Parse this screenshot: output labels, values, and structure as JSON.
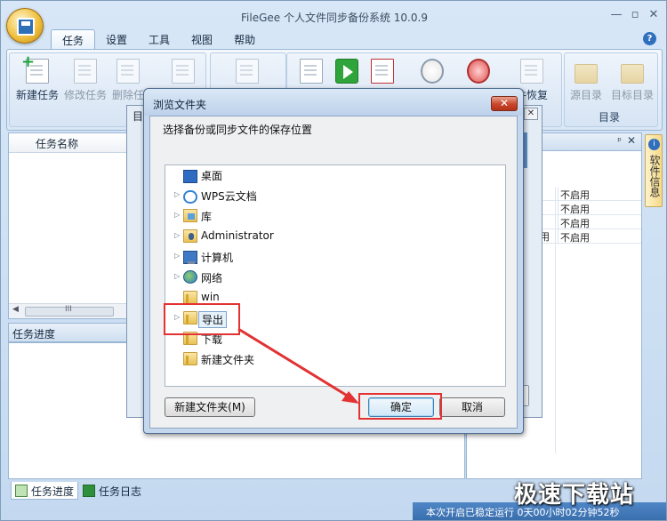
{
  "app": {
    "title": "FileGee 个人文件同步备份系统 10.0.9",
    "window_controls": [
      "—",
      "▫",
      "✕"
    ]
  },
  "menu": {
    "items": [
      "任务",
      "设置",
      "工具",
      "视图",
      "帮助"
    ],
    "active": "任务"
  },
  "ribbon": {
    "buttons": [
      {
        "label": "新建任务",
        "icon": "new-task-icon"
      },
      {
        "label": "修改任务",
        "icon": "edit-task-icon"
      },
      {
        "label": "删除任",
        "icon": "delete-task-icon"
      },
      {
        "label": "件恢复",
        "icon": "restore-icon"
      },
      {
        "label": "源目录",
        "icon": "source-folder-icon"
      },
      {
        "label": "目标目录",
        "icon": "target-folder-icon"
      }
    ],
    "group_label": "目录"
  },
  "left_pane": {
    "column_header": "任务名称",
    "scroll_marker": "III"
  },
  "progress_panel": {
    "title": "任务进度"
  },
  "bottom_tabs": [
    "任务进度",
    "任务日志"
  ],
  "right_pane": {
    "rows": [
      {
        "c1": "",
        "c2": "不启用"
      },
      {
        "c1": "",
        "c2": "不启用"
      },
      {
        "c1": "",
        "c2": "不启用"
      },
      {
        "c1": "用",
        "c2": "不启用"
      }
    ],
    "pin": "ᵖ",
    "close": "✕"
  },
  "side_tab": {
    "label": "软件信息"
  },
  "background_dialog": {
    "tab": "目",
    "close": "✕"
  },
  "dialog": {
    "title": "浏览文件夹",
    "close": "✕",
    "description": "选择备份或同步文件的保存位置",
    "tree": [
      {
        "label": "桌面",
        "icon": "desktop-icon",
        "arrow": ""
      },
      {
        "label": "WPS云文档",
        "icon": "cloud-icon",
        "arrow": "▷"
      },
      {
        "label": "库",
        "icon": "library-icon",
        "arrow": "▷"
      },
      {
        "label": "Administrator",
        "icon": "user-folder-icon",
        "arrow": "▷"
      },
      {
        "label": "计算机",
        "icon": "computer-icon",
        "arrow": "▷"
      },
      {
        "label": "网络",
        "icon": "network-icon",
        "arrow": "▷"
      },
      {
        "label": "win",
        "icon": "folder-icon",
        "arrow": ""
      },
      {
        "label": "导出",
        "icon": "folder-icon",
        "arrow": "▷",
        "selected": true
      },
      {
        "label": "下载",
        "icon": "folder-icon",
        "arrow": ""
      },
      {
        "label": "新建文件夹",
        "icon": "folder-icon",
        "arrow": ""
      }
    ],
    "new_folder_button": "新建文件夹(M)",
    "ok_button": "确定",
    "cancel_button": "取消"
  },
  "statusbar": {
    "text": "本次开启已稳定运行 0天00小时02分钟52秒"
  },
  "watermark": {
    "text": "极速下载站"
  },
  "colors": {
    "accent": "#4f86c6",
    "highlight": "#e23232"
  }
}
